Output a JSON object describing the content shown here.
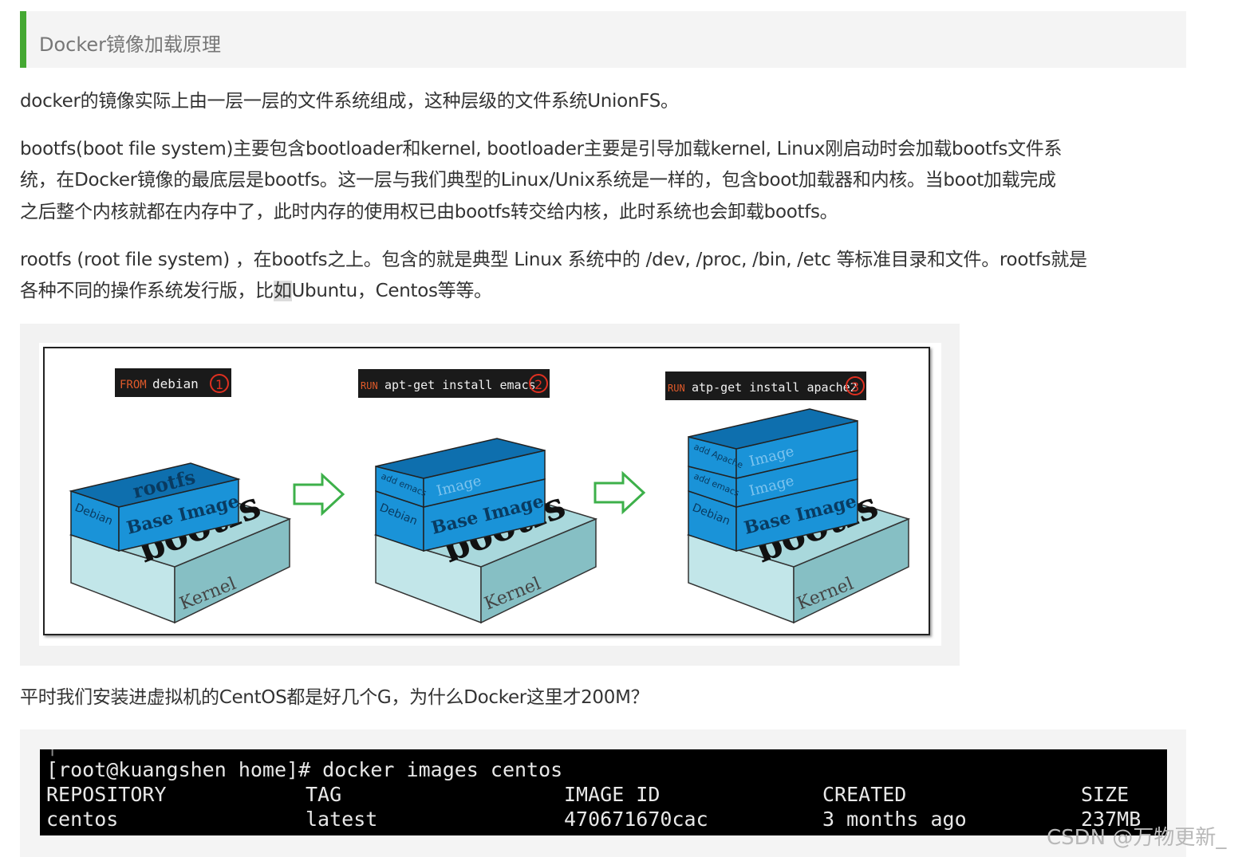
{
  "header": {
    "title": "Docker镜像加载原理"
  },
  "paragraphs": {
    "p1": "docker的镜像实际上由一层一层的文件系统组成，这种层级的文件系统UnionFS。",
    "p2_l1": "bootfs(boot file system)主要包含bootloader和kernel, bootloader主要是引导加载kernel, Linux刚启动时会加载bootfs文件系",
    "p2_l2": "统，在Docker镜像的最底层是bootfs。这一层与我们典型的Linux/Unix系统是一样的，包含boot加载器和内核。当boot加载完成",
    "p2_l3": "之后整个内核就都在内存中了，此时内存的使用权已由bootfs转交给内核，此时系统也会卸载bootfs。",
    "p3_l1": "rootfs (root file system) ，在bootfs之上。包含的就是典型 Linux 系统中的 /dev, /proc, /bin, /etc 等标准目录和文件。rootfs就是",
    "p3_l2a": "各种不同的操作系统发行版，比",
    "p3_l2b": "如",
    "p3_l2c": "Ubuntu，Centos等等。",
    "p4": "平时我们安装进虚拟机的CentOS都是好几个G，为什么Docker这里才200M？"
  },
  "diagram": {
    "steps": [
      {
        "keyword": "FROM",
        "text": "debian",
        "num": "1"
      },
      {
        "keyword": "RUN",
        "text": "apt-get install emacs",
        "num": "2"
      },
      {
        "keyword": "RUN",
        "text": "atp-get install apache2",
        "num": "3"
      }
    ],
    "labels": {
      "rootfs": "rootfs",
      "debian": "Debian",
      "base_image": "Base Image",
      "bootfs": "bootfs",
      "kernel": "Kernel",
      "add_emacs": "add emacs",
      "add_apache": "add Apache",
      "image": "Image"
    },
    "colors": {
      "image_blue": "#1a93d8",
      "image_blue_dark": "#0e6fae",
      "bootfs_teal": "#a9d8dc",
      "bootfs_teal_dark": "#86bfc4",
      "arrow_green": "#3db04a",
      "header_green": "#44a832"
    }
  },
  "terminal": {
    "prompt": "[root@kuangshen home]# docker images centos",
    "headers": [
      "REPOSITORY",
      "TAG",
      "IMAGE ID",
      "CREATED",
      "SIZE"
    ],
    "row": [
      "centos",
      "latest",
      "470671670cac",
      "3 months ago",
      "237MB"
    ]
  },
  "watermark": "CSDN @万物更新_"
}
